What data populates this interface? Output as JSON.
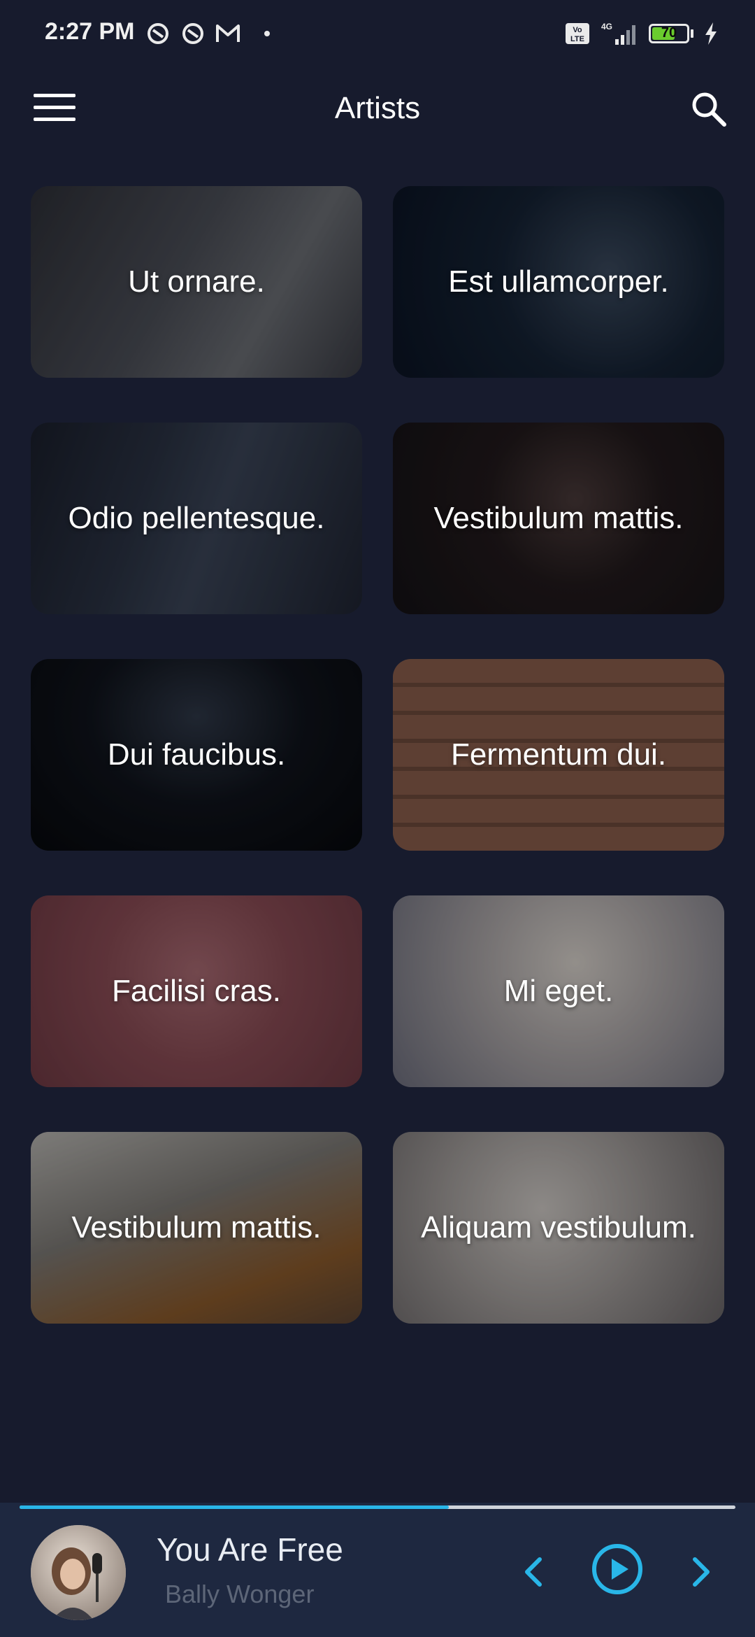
{
  "status_bar": {
    "time": "2:27 PM",
    "battery_level": "70",
    "battery_fraction": 0.7,
    "icons_left": [
      "app-notification-icon",
      "app-notification-icon",
      "gmail-icon",
      "dot-icon"
    ],
    "icons_right": [
      "volte-icon",
      "4g-signal-icon",
      "battery-icon",
      "charging-icon"
    ]
  },
  "header": {
    "title": "Artists",
    "menu_icon": "hamburger-menu-icon",
    "search_icon": "search-icon"
  },
  "artists": [
    {
      "name": "Ut ornare."
    },
    {
      "name": "Est ullamcorper."
    },
    {
      "name": "Odio pellentesque."
    },
    {
      "name": "Vestibulum mattis."
    },
    {
      "name": "Dui faucibus."
    },
    {
      "name": "Fermentum dui."
    },
    {
      "name": "Facilisi cras."
    },
    {
      "name": "Mi eget."
    },
    {
      "name": "Vestibulum mattis."
    },
    {
      "name": "Aliquam vestibulum."
    }
  ],
  "player": {
    "title": "You Are Free",
    "artist": "Bally Wonger",
    "progress": 0.6,
    "prev_icon": "chevron-left-icon",
    "play_icon": "play-circle-icon",
    "next_icon": "chevron-right-icon"
  },
  "colors": {
    "background": "#171b2d",
    "player_background": "#1e2840",
    "accent": "#29b6e8",
    "battery_fill": "#6acb2e"
  }
}
